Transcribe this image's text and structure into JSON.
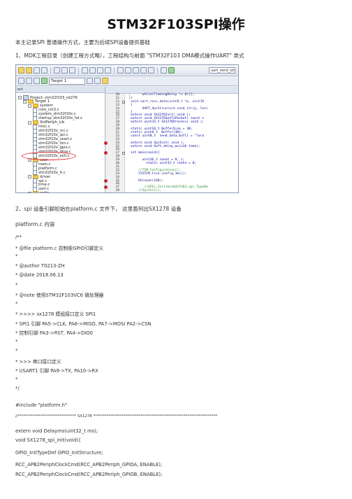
{
  "title": "STM32F103SPI操作",
  "intro": "本主记录SPI 普通操作方式，主要为后续SPI设备提供基础",
  "step1": "1、MDK工程目录（创建工程方式略），工程结构与前面 \"STM32F103 DMA模式操作UART\" 类式",
  "ide": {
    "target_label": "Target 1",
    "toolbar_input": "uart_send_str",
    "panel_title": "ect",
    "editor_tab": "main.c",
    "tree": [
      {
        "label": "Project: stm32f103_sd276",
        "level": 0,
        "icon": "project-icon"
      },
      {
        "label": "Target 1",
        "level": 1,
        "icon": "target-icon"
      },
      {
        "label": "system",
        "level": 2,
        "icon": "folder-icon"
      },
      {
        "label": "core_cm3.c",
        "level": 3,
        "icon": "file-icon"
      },
      {
        "label": "system_stm32f10x.c",
        "level": 3,
        "icon": "file-icon"
      },
      {
        "label": "startup_stm32f10x_hd.s",
        "level": 3,
        "icon": "file-icon"
      },
      {
        "label": "StdPeriph_Lib",
        "level": 2,
        "icon": "folder-icon"
      },
      {
        "label": "misc.c",
        "level": 3,
        "icon": "file-icon"
      },
      {
        "label": "stm32f10x_rcc.c",
        "level": 3,
        "icon": "file-icon"
      },
      {
        "label": "stm32f10x_spi.c",
        "level": 3,
        "icon": "file-icon"
      },
      {
        "label": "stm32f10x_usart.c",
        "level": 3,
        "icon": "file-icon"
      },
      {
        "label": "stm32f10x_tim.c",
        "level": 3,
        "icon": "file-icon"
      },
      {
        "label": "stm32f10x_gpio.c",
        "level": 3,
        "icon": "file-icon"
      },
      {
        "label": "stm32f10x_dma.c",
        "level": 3,
        "icon": "file-icon"
      },
      {
        "label": "stm32f10x_exti.c",
        "level": 3,
        "icon": "file-icon"
      },
      {
        "label": "user",
        "level": 2,
        "icon": "folder-icon"
      },
      {
        "label": "main.c",
        "level": 3,
        "icon": "file-icon"
      },
      {
        "label": "platform.c",
        "level": 3,
        "icon": "file-icon"
      },
      {
        "label": "stm32f10x_it.c",
        "level": 3,
        "icon": "file-icon"
      },
      {
        "label": "driver",
        "level": 2,
        "icon": "folder-icon"
      },
      {
        "label": "spi.c",
        "level": 3,
        "icon": "file-icon"
      },
      {
        "label": "time.c",
        "level": 3,
        "icon": "file-icon"
      },
      {
        "label": "uart.c",
        "level": 3,
        "icon": "file-icon"
      },
      {
        "label": "radio",
        "level": 2,
        "icon": "folder-icon"
      }
    ],
    "code": [
      {
        "ln": "10",
        "text": "      while(TimeingDelay != 0){};",
        "cls": ""
      },
      {
        "ln": "11",
        "text": "}",
        "cls": ""
      },
      {
        "ln": "12",
        "text": "void uart_recv_data(uint8_t *p, uint16",
        "cls": "",
        "fold": true
      },
      {
        "ln": "13",
        "text": "{",
        "cls": ""
      },
      {
        "ln": "14",
        "text": "      UART_ApiStructure.send_str(p, len)",
        "cls": ""
      },
      {
        "ln": "15",
        "text": "}",
        "cls": ""
      },
      {
        "ln": "16",
        "text": "extern void SX1276Init( void );",
        "cls": "kw"
      },
      {
        "ln": "17",
        "text": "extern void SX1276SetTxPacket( const v",
        "cls": "kw"
      },
      {
        "ln": "18",
        "text": "extern uint32_t SX1276Process( void );",
        "cls": "kw"
      },
      {
        "ln": "19",
        "text": "",
        "cls": ""
      },
      {
        "ln": "20",
        "text": "static uint16_t BufferSize = 30;",
        "cls": "kw"
      },
      {
        "ln": "21",
        "text": "static uint8_t  Buffer[30];",
        "cls": "kw"
      },
      {
        "ln": "22",
        "text": "const uint8_t  send_data_buf[] = \"lora",
        "cls": "kw"
      },
      {
        "ln": "23",
        "text": "",
        "cls": ""
      },
      {
        "ln": "24",
        "text": "extern void SpiInit( void );",
        "cls": "kw",
        "bp": true
      },
      {
        "ln": "25",
        "text": "extern void Soft_delay_ms(u16 time);",
        "cls": "kw"
      },
      {
        "ln": "26",
        "text": "",
        "cls": ""
      },
      {
        "ln": "27",
        "text": "int main(void){",
        "cls": "kw",
        "bp": true,
        "fold": true
      },
      {
        "ln": "28",
        "text": "",
        "cls": ""
      },
      {
        "ln": "29",
        "text": "      uint16_t count = 0, i;",
        "cls": "kw"
      },
      {
        "ln": "30",
        "text": "        static uint32_t state = 0;",
        "cls": "kw"
      },
      {
        "ln": "31",
        "text": "",
        "cls": ""
      },
      {
        "ln": "32",
        "text": "    //TIM_Configuration();",
        "cls": "cm"
      },
      {
        "ln": "33",
        "text": "    SYSTEM_tick_config_1ms();",
        "cls": ""
      },
      {
        "ln": "34",
        "text": "",
        "cls": ""
      },
      {
        "ln": "35",
        "text": "    Delayms(100);",
        "cls": "",
        "bp": true
      },
      {
        "ln": "36",
        "text": "",
        "cls": ""
      },
      {
        "ln": "37",
        "text": "       //SPIx_Init(&stm32f103_spi_TypeDe",
        "cls": "cm",
        "bp": true
      },
      {
        "ln": "38",
        "text": "    //SpiInit();",
        "cls": "cm"
      }
    ]
  },
  "step2": "2、spi 设备引脚初始在platform.c 文件下，  这里面列出SX1278 设备",
  "content_label": "platform.c 内容",
  "code_lines": [
    "/**",
    "* @file platform.c 控制板GPIO引脚定义",
    "*",
    "* @author T0213-ZH",
    "* @date 2018.06.13",
    "*",
    "* @note 使用STM32F103VC6 微处理器",
    "*",
    "* >>>> sx1278 模组接口定义 SPI1",
    "* SPI1 引脚 PA5->CLK, PA6->MISO, PA7->MOSI PA2->CSN",
    "* 控制引脚 PA3->RST, PA4->DIO0",
    "*",
    "*",
    "* >>> 串口接口定义",
    "* USART1 引脚 PA9->TX, PA10->RX",
    "*",
    "*/",
    "#include \"platform.h\"",
    "//******************************* SX1278 ******************************************************************",
    "extern void Delayms(uint32_t ms);",
    "void SX1278_spi_init(void){",
    "    GPIO_InitTypeDef GPIO_InitStructure;",
    "    RCC_APB2PeriphClockCmd(RCC_APB2Periph_GPIOA, ENABLE);",
    "    RCC_APB2PeriphClockCmd(RCC_APB2Periph_GPIOB, ENABLE);"
  ]
}
